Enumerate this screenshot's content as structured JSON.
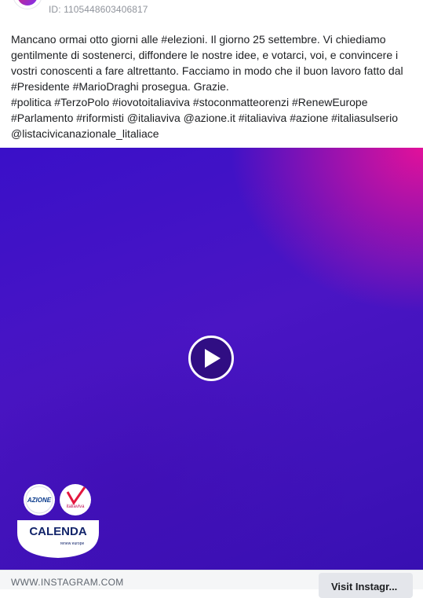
{
  "ad": {
    "id_label": "ID: 1105448603406817"
  },
  "post": {
    "caption": "Mancano ormai otto giorni alle #elezioni. Il giorno 25 settembre. Vi chiediamo gentilmente di sostenerci, diffondere le nostre idee, e votarci, voi, e convincere i vostri conoscenti a fare altrettanto. Facciamo in modo che il buon lavoro fatto dal #Presidente #MarioDraghi prosegua. Grazie.\n#politica #TerzoPolo #iovotoitaliaviva #stoconmatteorenzi #RenewEurope #Parlamento #riformisti @italiaviva @azione.it #italiaviva #azione #italiasulserio @listacivicanazionale_litaliace"
  },
  "media": {
    "type": "video",
    "play_icon": "play-icon",
    "logo": {
      "party_left": "AZIONE",
      "party_right": "italiaviva",
      "name": "CALENDA",
      "subtitle": "renew europe"
    },
    "colors": {
      "base": "#3a10c8",
      "accent": "#e2119a"
    }
  },
  "footer": {
    "source": "WWW.INSTAGRAM.COM",
    "cta": "Visit Instagr..."
  }
}
